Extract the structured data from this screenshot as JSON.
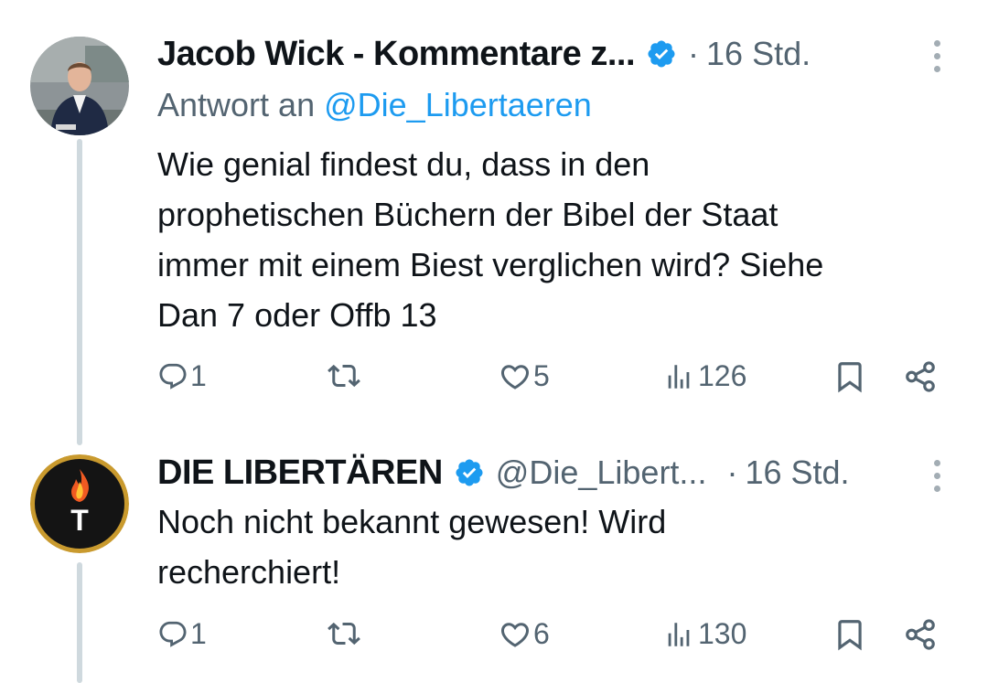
{
  "tweets": [
    {
      "author": "Jacob Wick - Kommentare z...",
      "verified": true,
      "handle": "",
      "time": "16 Std.",
      "reply_to_label": "Antwort an",
      "reply_to_handle": "@Die_Libertaeren",
      "text_lines": [
        "Wie genial findest du, dass in den",
        "prophetischen Büchern der Bibel der Staat",
        "immer mit einem Biest verglichen wird? Siehe",
        "Dan 7 oder Offb 13"
      ],
      "replies": "1",
      "reposts": "",
      "likes": "5",
      "views": "126"
    },
    {
      "author": "DIE LIBERTÄREN",
      "verified": true,
      "handle": "@Die_Libert...",
      "time": "16 Std.",
      "avatar_letter": "T",
      "text_lines": [
        "Noch nicht bekannt gewesen! Wird",
        "recherchiert!"
      ],
      "replies": "1",
      "reposts": "",
      "likes": "6",
      "views": "130"
    }
  ],
  "separator": "·",
  "colors": {
    "text": "#0f1419",
    "secondary": "#536471",
    "link": "#1d9bf0",
    "verified": "#1d9bf0",
    "thread_line": "#cfd9de"
  },
  "icons": [
    "reply-icon",
    "repost-icon",
    "like-icon",
    "views-icon",
    "bookmark-icon",
    "share-icon",
    "verified-badge-icon",
    "more-options-icon"
  ]
}
